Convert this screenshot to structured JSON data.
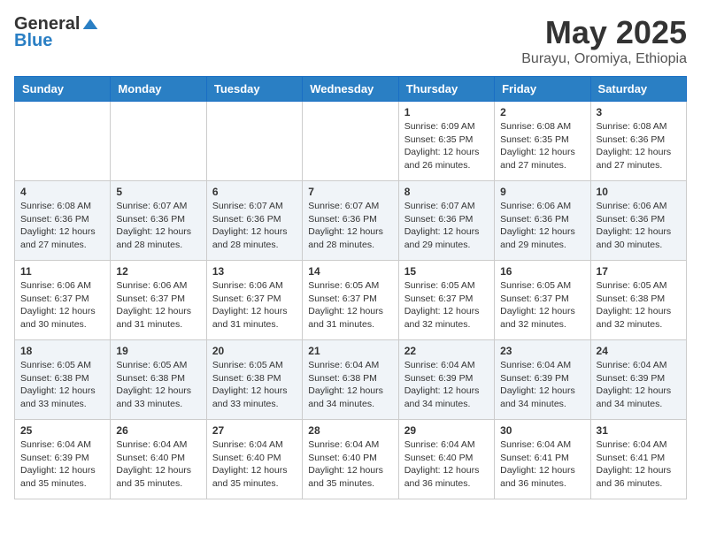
{
  "header": {
    "logo_general": "General",
    "logo_blue": "Blue",
    "month_title": "May 2025",
    "location": "Burayu, Oromiya, Ethiopia"
  },
  "days_of_week": [
    "Sunday",
    "Monday",
    "Tuesday",
    "Wednesday",
    "Thursday",
    "Friday",
    "Saturday"
  ],
  "weeks": [
    [
      {
        "day": "",
        "info": ""
      },
      {
        "day": "",
        "info": ""
      },
      {
        "day": "",
        "info": ""
      },
      {
        "day": "",
        "info": ""
      },
      {
        "day": "1",
        "info": "Sunrise: 6:09 AM\nSunset: 6:35 PM\nDaylight: 12 hours\nand 26 minutes."
      },
      {
        "day": "2",
        "info": "Sunrise: 6:08 AM\nSunset: 6:35 PM\nDaylight: 12 hours\nand 27 minutes."
      },
      {
        "day": "3",
        "info": "Sunrise: 6:08 AM\nSunset: 6:36 PM\nDaylight: 12 hours\nand 27 minutes."
      }
    ],
    [
      {
        "day": "4",
        "info": "Sunrise: 6:08 AM\nSunset: 6:36 PM\nDaylight: 12 hours\nand 27 minutes."
      },
      {
        "day": "5",
        "info": "Sunrise: 6:07 AM\nSunset: 6:36 PM\nDaylight: 12 hours\nand 28 minutes."
      },
      {
        "day": "6",
        "info": "Sunrise: 6:07 AM\nSunset: 6:36 PM\nDaylight: 12 hours\nand 28 minutes."
      },
      {
        "day": "7",
        "info": "Sunrise: 6:07 AM\nSunset: 6:36 PM\nDaylight: 12 hours\nand 28 minutes."
      },
      {
        "day": "8",
        "info": "Sunrise: 6:07 AM\nSunset: 6:36 PM\nDaylight: 12 hours\nand 29 minutes."
      },
      {
        "day": "9",
        "info": "Sunrise: 6:06 AM\nSunset: 6:36 PM\nDaylight: 12 hours\nand 29 minutes."
      },
      {
        "day": "10",
        "info": "Sunrise: 6:06 AM\nSunset: 6:36 PM\nDaylight: 12 hours\nand 30 minutes."
      }
    ],
    [
      {
        "day": "11",
        "info": "Sunrise: 6:06 AM\nSunset: 6:37 PM\nDaylight: 12 hours\nand 30 minutes."
      },
      {
        "day": "12",
        "info": "Sunrise: 6:06 AM\nSunset: 6:37 PM\nDaylight: 12 hours\nand 31 minutes."
      },
      {
        "day": "13",
        "info": "Sunrise: 6:06 AM\nSunset: 6:37 PM\nDaylight: 12 hours\nand 31 minutes."
      },
      {
        "day": "14",
        "info": "Sunrise: 6:05 AM\nSunset: 6:37 PM\nDaylight: 12 hours\nand 31 minutes."
      },
      {
        "day": "15",
        "info": "Sunrise: 6:05 AM\nSunset: 6:37 PM\nDaylight: 12 hours\nand 32 minutes."
      },
      {
        "day": "16",
        "info": "Sunrise: 6:05 AM\nSunset: 6:37 PM\nDaylight: 12 hours\nand 32 minutes."
      },
      {
        "day": "17",
        "info": "Sunrise: 6:05 AM\nSunset: 6:38 PM\nDaylight: 12 hours\nand 32 minutes."
      }
    ],
    [
      {
        "day": "18",
        "info": "Sunrise: 6:05 AM\nSunset: 6:38 PM\nDaylight: 12 hours\nand 33 minutes."
      },
      {
        "day": "19",
        "info": "Sunrise: 6:05 AM\nSunset: 6:38 PM\nDaylight: 12 hours\nand 33 minutes."
      },
      {
        "day": "20",
        "info": "Sunrise: 6:05 AM\nSunset: 6:38 PM\nDaylight: 12 hours\nand 33 minutes."
      },
      {
        "day": "21",
        "info": "Sunrise: 6:04 AM\nSunset: 6:38 PM\nDaylight: 12 hours\nand 34 minutes."
      },
      {
        "day": "22",
        "info": "Sunrise: 6:04 AM\nSunset: 6:39 PM\nDaylight: 12 hours\nand 34 minutes."
      },
      {
        "day": "23",
        "info": "Sunrise: 6:04 AM\nSunset: 6:39 PM\nDaylight: 12 hours\nand 34 minutes."
      },
      {
        "day": "24",
        "info": "Sunrise: 6:04 AM\nSunset: 6:39 PM\nDaylight: 12 hours\nand 34 minutes."
      }
    ],
    [
      {
        "day": "25",
        "info": "Sunrise: 6:04 AM\nSunset: 6:39 PM\nDaylight: 12 hours\nand 35 minutes."
      },
      {
        "day": "26",
        "info": "Sunrise: 6:04 AM\nSunset: 6:40 PM\nDaylight: 12 hours\nand 35 minutes."
      },
      {
        "day": "27",
        "info": "Sunrise: 6:04 AM\nSunset: 6:40 PM\nDaylight: 12 hours\nand 35 minutes."
      },
      {
        "day": "28",
        "info": "Sunrise: 6:04 AM\nSunset: 6:40 PM\nDaylight: 12 hours\nand 35 minutes."
      },
      {
        "day": "29",
        "info": "Sunrise: 6:04 AM\nSunset: 6:40 PM\nDaylight: 12 hours\nand 36 minutes."
      },
      {
        "day": "30",
        "info": "Sunrise: 6:04 AM\nSunset: 6:41 PM\nDaylight: 12 hours\nand 36 minutes."
      },
      {
        "day": "31",
        "info": "Sunrise: 6:04 AM\nSunset: 6:41 PM\nDaylight: 12 hours\nand 36 minutes."
      }
    ]
  ]
}
